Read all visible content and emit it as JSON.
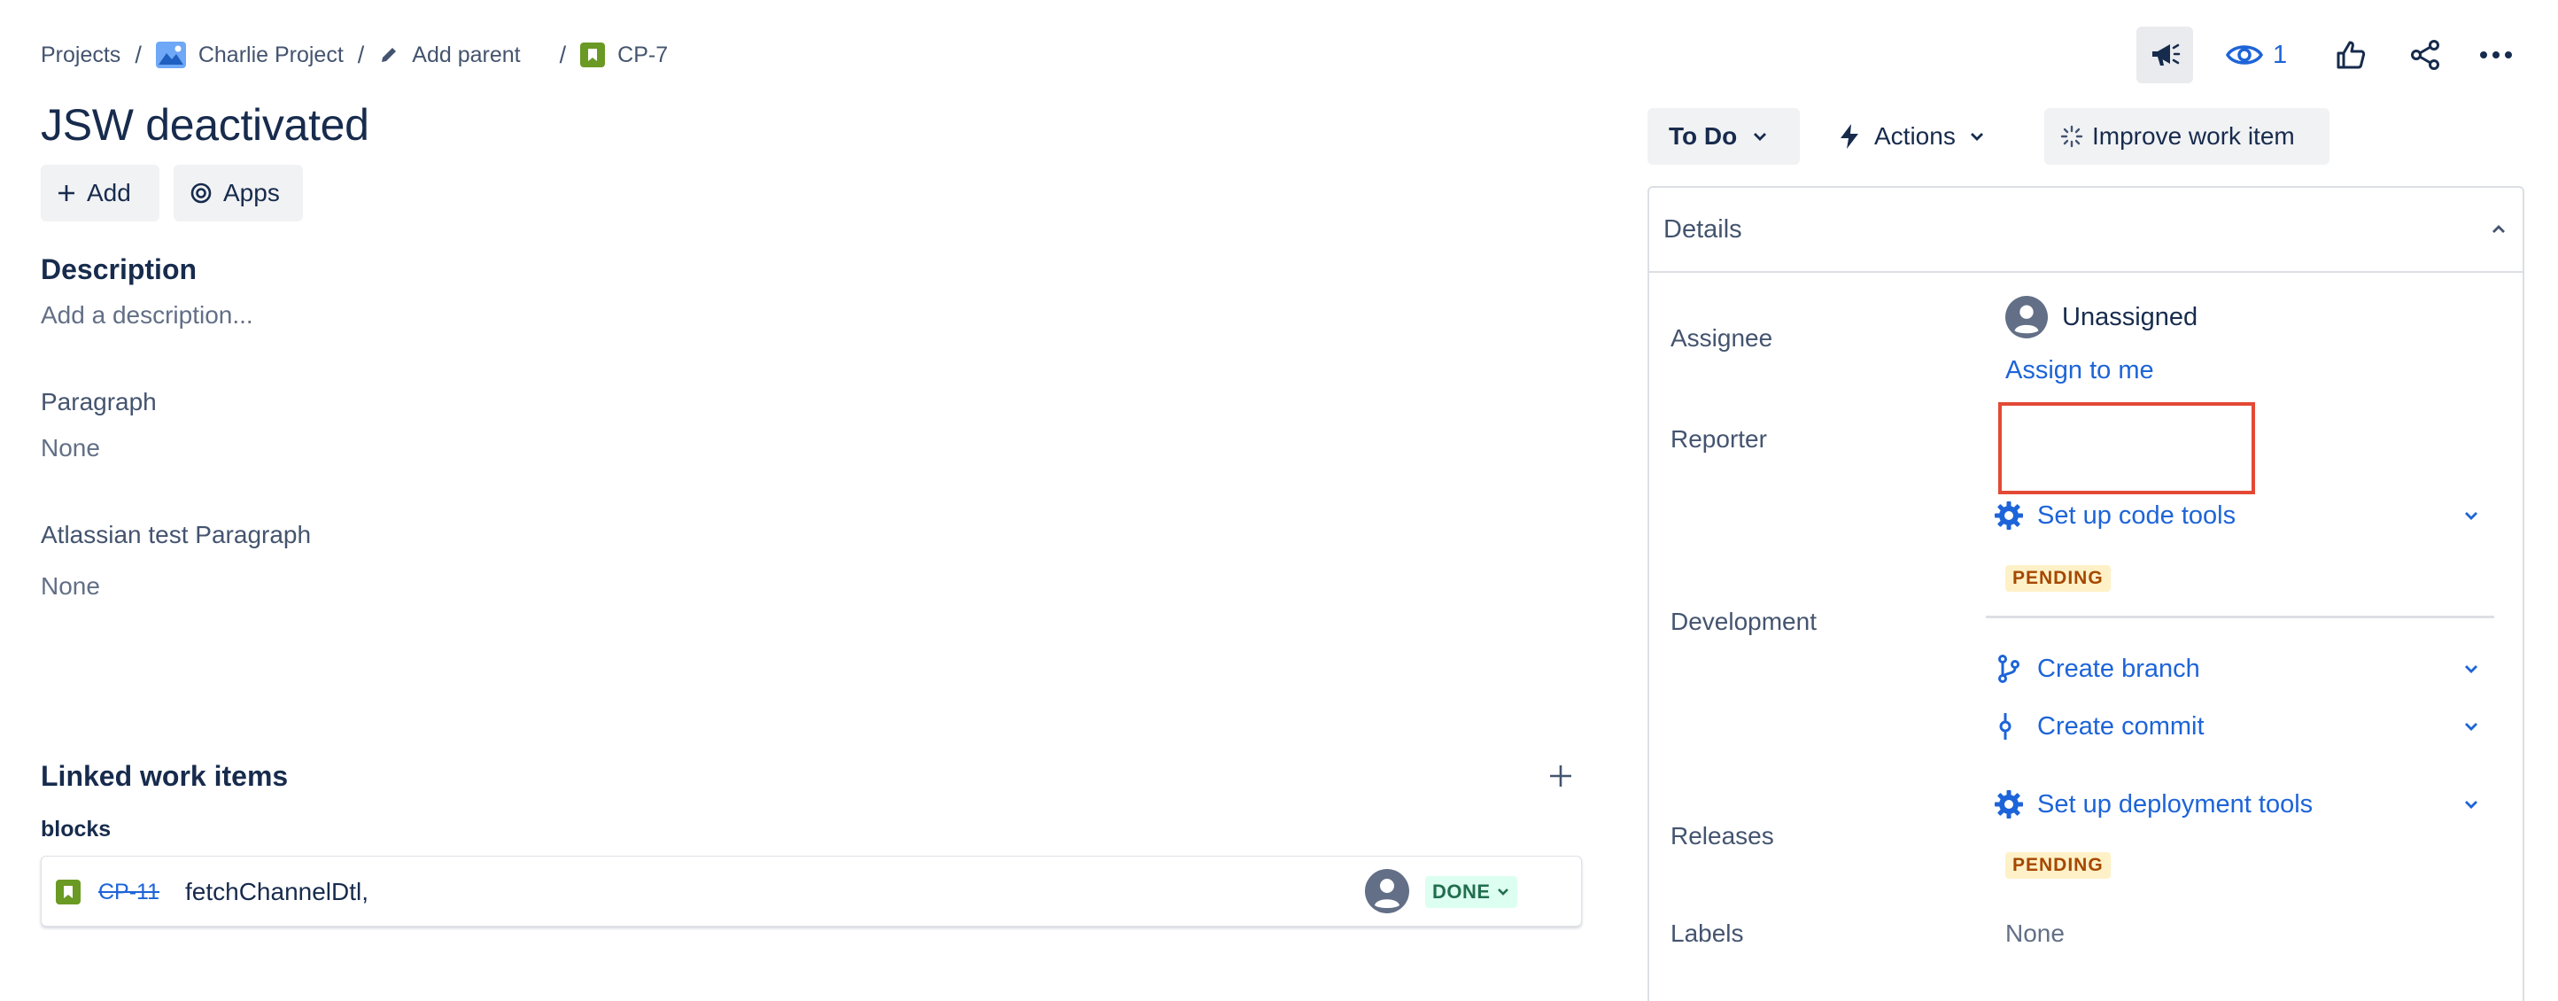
{
  "breadcrumb": {
    "projects": "Projects",
    "project": "Charlie Project",
    "add_parent": "Add parent",
    "issue_key": "CP-7",
    "separator": "/"
  },
  "toolbar": {
    "watch_count": "1"
  },
  "title": "JSW deactivated",
  "actions": {
    "add": "Add",
    "apps": "Apps"
  },
  "description": {
    "heading": "Description",
    "placeholder": "Add a description..."
  },
  "fields": [
    {
      "label": "Paragraph",
      "value": "None"
    },
    {
      "label": "Atlassian test Paragraph",
      "value": "None"
    }
  ],
  "linked": {
    "heading": "Linked work items",
    "relation": "blocks",
    "item": {
      "key": "CP-11",
      "summary": "fetchChannelDtl,",
      "status": "DONE"
    }
  },
  "status_bar": {
    "status": "To Do",
    "actions": "Actions",
    "improve": "Improve work item"
  },
  "details": {
    "heading": "Details",
    "assignee_label": "Assignee",
    "assignee_value": "Unassigned",
    "assign_to_me": "Assign to me",
    "reporter_label": "Reporter",
    "development_label": "Development",
    "setup_code": "Set up code tools",
    "pending": "PENDING",
    "create_branch": "Create branch",
    "create_commit": "Create commit",
    "releases_label": "Releases",
    "setup_deploy": "Set up deployment tools",
    "labels_label": "Labels",
    "labels_value": "None"
  },
  "colors": {
    "accent": "#1d64d8",
    "highlight_box": "#e34935",
    "story_green": "#6a9a23",
    "done_green": "#216e4e",
    "pending_bg": "#fff1c7"
  }
}
